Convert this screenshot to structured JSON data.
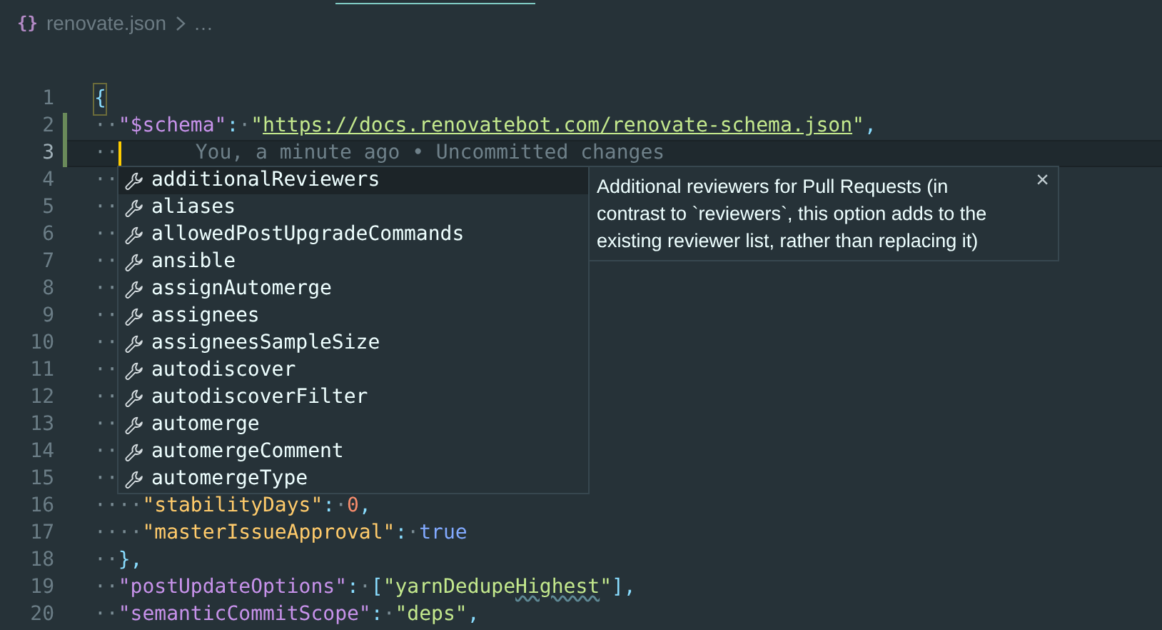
{
  "breadcrumb": {
    "icon": "{}",
    "file": "renovate.json",
    "more": "…"
  },
  "editor": {
    "lines": [
      {
        "number": "1",
        "modified": false,
        "current": false,
        "tokens": [
          {
            "kind": "brace-match",
            "text": "{"
          }
        ]
      },
      {
        "number": "2",
        "modified": true,
        "current": false,
        "tokens": [
          {
            "kind": "ws",
            "text": "··"
          },
          {
            "kind": "key",
            "text": "\"$schema\""
          },
          {
            "kind": "punct",
            "text": ":"
          },
          {
            "kind": "ws",
            "text": "·"
          },
          {
            "kind": "string",
            "text": "\""
          },
          {
            "kind": "link",
            "text": "https://docs.renovatebot.com/renovate-schema.json"
          },
          {
            "kind": "string",
            "text": "\""
          },
          {
            "kind": "punct",
            "text": ","
          }
        ]
      },
      {
        "number": "3",
        "modified": true,
        "current": true,
        "tokens": [
          {
            "kind": "ws",
            "text": "··"
          },
          {
            "kind": "cursor"
          },
          {
            "kind": "blame",
            "text": "You, a minute ago • Uncommitted changes"
          }
        ]
      },
      {
        "number": "4",
        "modified": false,
        "current": false,
        "tokens": [
          {
            "kind": "ws",
            "text": "··"
          }
        ]
      },
      {
        "number": "5",
        "modified": false,
        "current": false,
        "tokens": [
          {
            "kind": "ws",
            "text": "··"
          }
        ]
      },
      {
        "number": "6",
        "modified": false,
        "current": false,
        "tokens": [
          {
            "kind": "ws",
            "text": "··"
          }
        ]
      },
      {
        "number": "7",
        "modified": false,
        "current": false,
        "tokens": [
          {
            "kind": "ws",
            "text": "··"
          }
        ]
      },
      {
        "number": "8",
        "modified": false,
        "current": false,
        "tokens": [
          {
            "kind": "ws",
            "text": "··"
          }
        ]
      },
      {
        "number": "9",
        "modified": false,
        "current": false,
        "tokens": [
          {
            "kind": "ws",
            "text": "··"
          }
        ]
      },
      {
        "number": "10",
        "modified": false,
        "current": false,
        "tokens": [
          {
            "kind": "ws",
            "text": "··"
          }
        ]
      },
      {
        "number": "11",
        "modified": false,
        "current": false,
        "tokens": [
          {
            "kind": "ws",
            "text": "··"
          }
        ]
      },
      {
        "number": "12",
        "modified": false,
        "current": false,
        "tokens": [
          {
            "kind": "ws",
            "text": "··"
          }
        ]
      },
      {
        "number": "13",
        "modified": false,
        "current": false,
        "tokens": [
          {
            "kind": "ws",
            "text": "··"
          }
        ]
      },
      {
        "number": "14",
        "modified": false,
        "current": false,
        "tokens": [
          {
            "kind": "ws",
            "text": "··"
          }
        ]
      },
      {
        "number": "15",
        "modified": false,
        "current": false,
        "tokens": [
          {
            "kind": "ws",
            "text": "··"
          }
        ]
      },
      {
        "number": "16",
        "modified": false,
        "current": false,
        "tokens": [
          {
            "kind": "ws",
            "text": "····"
          },
          {
            "kind": "key2",
            "text": "\"stabilityDays\""
          },
          {
            "kind": "punct",
            "text": ":"
          },
          {
            "kind": "ws",
            "text": "·"
          },
          {
            "kind": "number",
            "text": "0"
          },
          {
            "kind": "punct",
            "text": ","
          }
        ]
      },
      {
        "number": "17",
        "modified": false,
        "current": false,
        "tokens": [
          {
            "kind": "ws",
            "text": "····"
          },
          {
            "kind": "key2",
            "text": "\"masterIssueApproval\""
          },
          {
            "kind": "punct",
            "text": ":"
          },
          {
            "kind": "ws",
            "text": "·"
          },
          {
            "kind": "bool",
            "text": "true"
          }
        ]
      },
      {
        "number": "18",
        "modified": false,
        "current": false,
        "tokens": [
          {
            "kind": "ws",
            "text": "··"
          },
          {
            "kind": "punct",
            "text": "},"
          }
        ]
      },
      {
        "number": "19",
        "modified": false,
        "current": false,
        "tokens": [
          {
            "kind": "ws",
            "text": "··"
          },
          {
            "kind": "key",
            "text": "\"postUpdateOptions\""
          },
          {
            "kind": "punct",
            "text": ":"
          },
          {
            "kind": "ws",
            "text": "·"
          },
          {
            "kind": "punct",
            "text": "["
          },
          {
            "kind": "string",
            "text": "\"yarnDedupe"
          },
          {
            "kind": "spell",
            "text": "Highest"
          },
          {
            "kind": "string",
            "text": "\""
          },
          {
            "kind": "punct",
            "text": "],"
          }
        ]
      },
      {
        "number": "20",
        "modified": false,
        "current": false,
        "tokens": [
          {
            "kind": "ws",
            "text": "··"
          },
          {
            "kind": "key",
            "text": "\"semanticCommitScope\""
          },
          {
            "kind": "punct",
            "text": ":"
          },
          {
            "kind": "ws",
            "text": "·"
          },
          {
            "kind": "string",
            "text": "\"deps\""
          },
          {
            "kind": "punct",
            "text": ","
          }
        ]
      }
    ]
  },
  "suggest": {
    "items": [
      {
        "label": "additionalReviewers",
        "selected": true
      },
      {
        "label": "aliases",
        "selected": false
      },
      {
        "label": "allowedPostUpgradeCommands",
        "selected": false
      },
      {
        "label": "ansible",
        "selected": false
      },
      {
        "label": "assignAutomerge",
        "selected": false
      },
      {
        "label": "assignees",
        "selected": false
      },
      {
        "label": "assigneesSampleSize",
        "selected": false
      },
      {
        "label": "autodiscover",
        "selected": false
      },
      {
        "label": "autodiscoverFilter",
        "selected": false
      },
      {
        "label": "automerge",
        "selected": false
      },
      {
        "label": "automergeComment",
        "selected": false
      },
      {
        "label": "automergeType",
        "selected": false
      }
    ],
    "detail": "Additional reviewers for Pull Requests (in contrast to `reviewers`, this option adds to the existing reviewer list, rather than replacing it)",
    "close": "×"
  }
}
